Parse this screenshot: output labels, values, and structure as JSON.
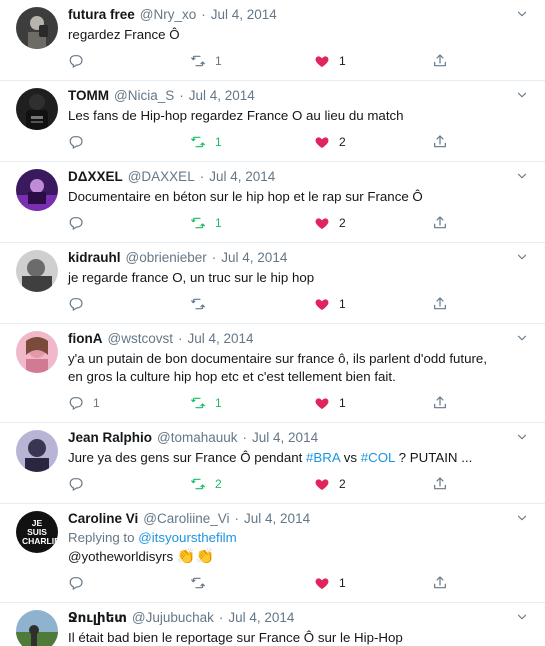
{
  "colors": {
    "accent": "#1b95e0",
    "retweet": "#17bf63",
    "like": "#e0245e",
    "muted": "#657786"
  },
  "tweets": [
    {
      "name": "futura free",
      "handle": "@Nry_xo",
      "date": "Jul 4, 2014",
      "text": "regardez France Ô",
      "replies": "",
      "retweets": "1",
      "likes": "1",
      "retweeted": false
    },
    {
      "name": "TOMM",
      "handle": "@Nicia_S",
      "date": "Jul 4, 2014",
      "text": "Les fans de Hip-hop regardez France O au lieu du match",
      "replies": "",
      "retweets": "1",
      "likes": "2",
      "retweeted": true
    },
    {
      "name": "DΔXXEL",
      "handle": "@DAXXEL",
      "date": "Jul 4, 2014",
      "text": "Documentaire en béton sur le hip hop et le rap sur France Ô",
      "replies": "",
      "retweets": "1",
      "likes": "2",
      "retweeted": true
    },
    {
      "name": "kidrauhl",
      "handle": "@obrienieber",
      "date": "Jul 4, 2014",
      "text": "je regarde france O, un truc sur le hip hop",
      "replies": "",
      "retweets": "",
      "likes": "1",
      "retweeted": false
    },
    {
      "name": "fionA",
      "handle": "@wstcovst",
      "date": "Jul 4, 2014",
      "text_line1": "y'a un putain de bon documentaire sur france ô, ils parlent d'odd future,",
      "text_line2": "en gros la culture hip hop etc et c'est tellement bien fait.",
      "replies": "1",
      "retweets": "1",
      "likes": "1",
      "retweeted": true
    },
    {
      "name": "Jean Ralphio",
      "handle": "@tomahauuk",
      "date": "Jul 4, 2014",
      "text_a": "Jure ya des gens sur France Ô pendant ",
      "tag1": "#BRA",
      "text_b": " vs ",
      "tag2": "#COL",
      "text_c": " ? PUTAIN ...",
      "replies": "",
      "retweets": "2",
      "likes": "2",
      "retweeted": true
    },
    {
      "name": "Caroline Vi",
      "handle": "@Caroliine_Vi",
      "date": "Jul 4, 2014",
      "replying_label": "Replying to ",
      "replying_handle": "@itsyoursthefilm",
      "text": "@yotheworldisyrs ",
      "emoji": "👏👏",
      "replies": "",
      "retweets": "",
      "likes": "1",
      "retweeted": false,
      "avatar_text": "JE SUIS CHARLIE"
    },
    {
      "name": "Ջուլիետ",
      "handle": "@Jujubuchak",
      "date": "Jul 4, 2014",
      "text": "Il était bad bien le reportage sur France Ô sur le Hip-Hop"
    }
  ],
  "dot": "·"
}
